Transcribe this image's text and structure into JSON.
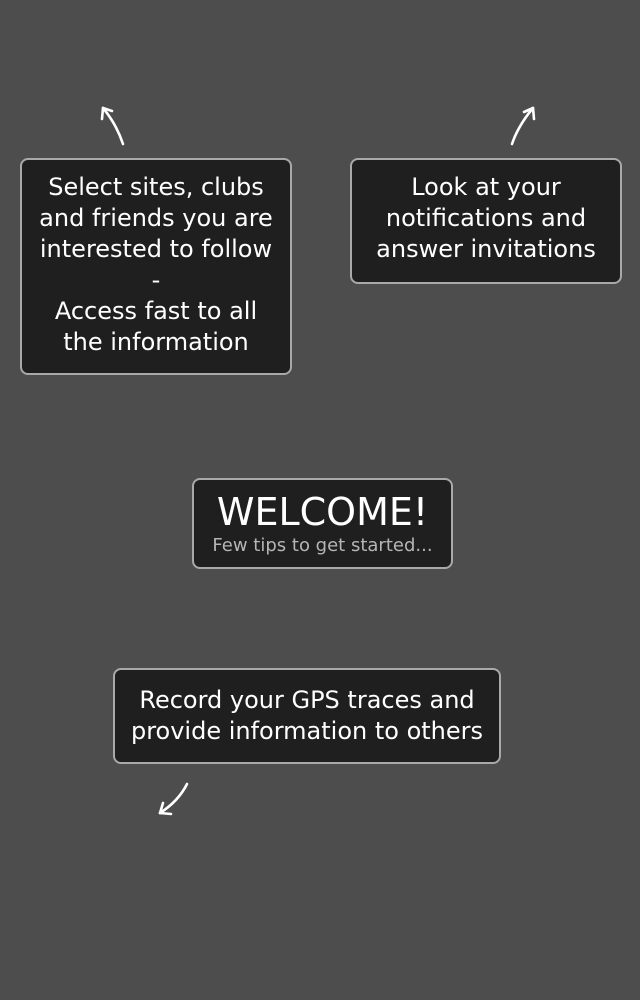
{
  "welcome": {
    "title": "WELCOME!",
    "subtitle": "Few tips to get started..."
  },
  "tips": {
    "follow": {
      "lines": [
        "Select sites, clubs",
        "and friends you are",
        "interested to follow",
        "-",
        "Access fast to all",
        "the information"
      ],
      "pointer_icon": "arrow-up-left-icon"
    },
    "notifications": {
      "lines": [
        "Look at your",
        "notifications and",
        "answer invitations"
      ],
      "pointer_icon": "arrow-up-right-icon"
    },
    "record": {
      "lines": [
        "Record your GPS traces and",
        "provide information to others"
      ],
      "pointer_icon": "arrow-down-left-icon"
    }
  },
  "colors": {
    "background": "#4d4d4d",
    "box_background": "#1f1f1f",
    "box_border": "#a9a9a9",
    "text": "#ffffff",
    "subtitle_text": "#b5b5b5"
  }
}
